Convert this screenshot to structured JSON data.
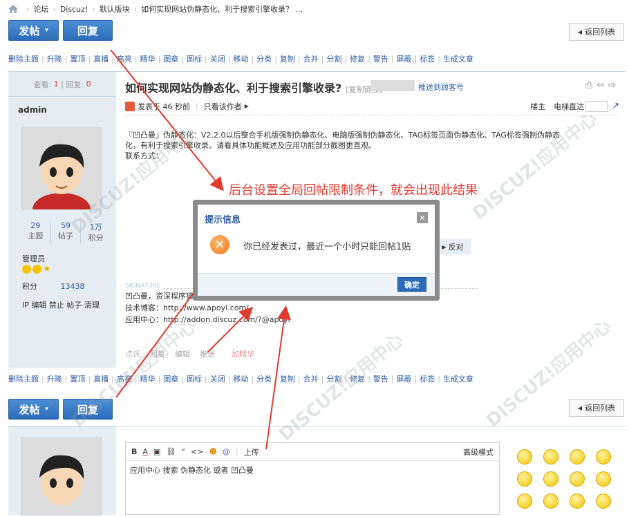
{
  "breadcrumb": {
    "items": [
      "论坛",
      "Discuz!",
      "默认版块",
      "如何实现网站伪静态化、利于搜索引擎收录？ ..."
    ]
  },
  "toolbar": {
    "post_label": "发帖",
    "reply_label": "回复",
    "back_label": "返回列表"
  },
  "mod_actions": [
    "删除主题",
    "升降",
    "置顶",
    "直播",
    "高亮",
    "精华",
    "图章",
    "图标",
    "关闭",
    "移动",
    "分类",
    "复制",
    "合并",
    "分割",
    "修复",
    "警告",
    "屏蔽",
    "标签",
    "生成文章"
  ],
  "thread": {
    "views_label": "查看:",
    "views": "1",
    "replies_label": "回复:",
    "replies": "0",
    "title": "如何实现网站伪静态化、利于搜索引擎收录?",
    "copy_link": "[复制链接]",
    "push_link": "推送到顾客号",
    "author": "admin",
    "posted": "发表于 46 秒前",
    "only_author": "只看该作者",
    "floor": "楼主",
    "elevator": "电梯直达",
    "content_line1": "『凹凸曼』伪静态化：V2.2.0以后整合手机版强制伪静态化、电脑版强制伪静态化、TAG标签页面伪静态化、TAG标签强制伪静态",
    "content_line2": "化，有利于搜索引擎收录。请看具体功能概述及应用功能部分截图更直观。",
    "content_line3": "联系方式：",
    "oppose": "反对",
    "signature_label": "SIGNATURE",
    "sig1": "凹凸曼，资深程序猿屌丝。致力于开源系统二次开发，定制开发，系统运维。",
    "sig2": "技术博客：http://www.apoyl.com/",
    "sig3": "应用中心：http://addon.discuz.com/?@apoyl",
    "actions": [
      "点评",
      "回复",
      "编辑",
      "推送",
      "加精华"
    ]
  },
  "profile": {
    "threads": "29",
    "threads_label": "主题",
    "posts": "59",
    "posts_label": "帖子",
    "credits": "1万",
    "credits_label": "积分",
    "group": "管理员",
    "score_label": "积分",
    "score": "13438",
    "admin_links": "IP 编辑 禁止 帖子 清理"
  },
  "annotation": "后台设置全局回帖限制条件，就会出现此结果",
  "dialog": {
    "title": "提示信息",
    "message": "你已经发表过，最近一个小时只能回帖1贴",
    "ok": "确定"
  },
  "editor": {
    "advanced": "高级模式",
    "upload": "上传",
    "text": "应用中心 搜索 伪静态化 或者 凹凸曼"
  },
  "colors": {
    "accent": "#2b5aa0",
    "button": "#2d6cba",
    "annotation": "#e03a2f"
  }
}
